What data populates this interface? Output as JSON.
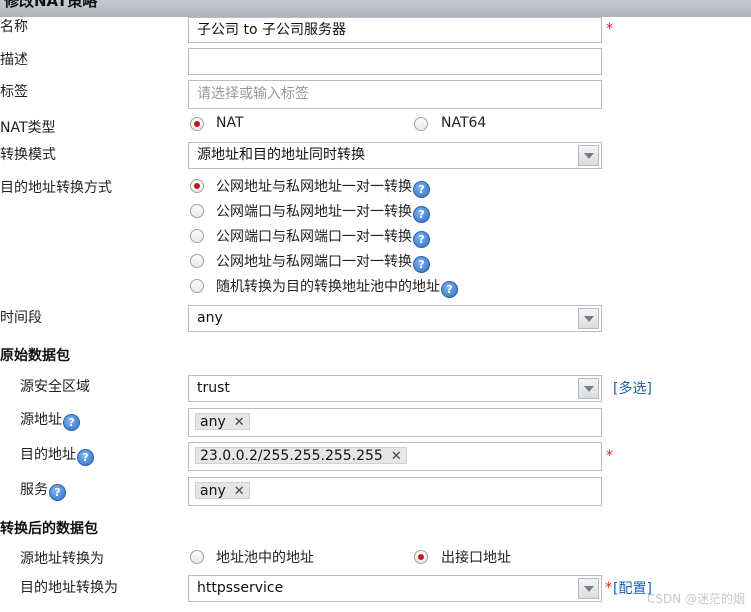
{
  "window": {
    "title": "修改NAT策略"
  },
  "form": {
    "name": {
      "label": "名称",
      "value": "子公司 to 子公司服务器"
    },
    "description": {
      "label": "描述",
      "value": ""
    },
    "tags": {
      "label": "标签",
      "placeholder": "请选择或输入标签"
    },
    "nat_type": {
      "label": "NAT类型",
      "options": [
        "NAT",
        "NAT64"
      ],
      "selected": "NAT"
    },
    "convert_mode": {
      "label": "转换模式",
      "value": "源地址和目的地址同时转换"
    },
    "dest_convert_method": {
      "label": "目的地址转换方式",
      "options": [
        "公网地址与私网地址一对一转换",
        "公网端口与私网地址一对一转换",
        "公网端口与私网端口一对一转换",
        "公网地址与私网端口一对一转换",
        "随机转换为目的转换地址池中的地址"
      ],
      "selected_index": 0
    },
    "time_range": {
      "label": "时间段",
      "value": "any"
    }
  },
  "original_packet": {
    "heading": "原始数据包",
    "source_zone": {
      "label": "源安全区域",
      "value": "trust",
      "multi_select_link": "[多选]"
    },
    "source_address": {
      "label": "源地址",
      "tag": "any"
    },
    "dest_address": {
      "label": "目的地址",
      "tag": "23.0.0.2/255.255.255.255"
    },
    "service": {
      "label": "服务",
      "tag": "any"
    }
  },
  "translated_packet": {
    "heading": "转换后的数据包",
    "source_convert": {
      "label": "源地址转换为",
      "options": [
        "地址池中的地址",
        "出接口地址"
      ],
      "selected": "出接口地址"
    },
    "dest_convert": {
      "label": "目的地址转换为",
      "value": "httpsservice",
      "config_link": "[配置]"
    }
  },
  "misc": {
    "required_mark": "*",
    "help_glyph": "?",
    "remove_glyph": "✕",
    "watermark": "CSDN @迷茫的烟"
  },
  "colors": {
    "required": "#e02020",
    "radio_selected": "#c4161c",
    "link": "#1a5fb4",
    "help_icon": "#2d6fc4"
  }
}
